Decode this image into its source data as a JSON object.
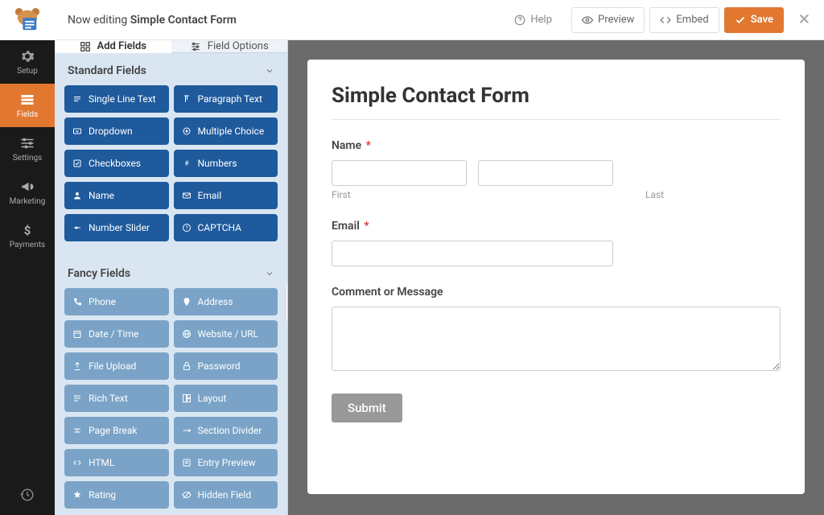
{
  "topbar": {
    "editing_prefix": "Now editing ",
    "editing_name": "Simple Contact Form",
    "help": "Help",
    "preview": "Preview",
    "embed": "Embed",
    "save": "Save"
  },
  "rail": {
    "setup": "Setup",
    "fields": "Fields",
    "settings": "Settings",
    "marketing": "Marketing",
    "payments": "Payments"
  },
  "panel": {
    "tab_add": "Add Fields",
    "tab_options": "Field Options",
    "section_standard": "Standard Fields",
    "section_fancy": "Fancy Fields",
    "standard_fields": [
      "Single Line Text",
      "Paragraph Text",
      "Dropdown",
      "Multiple Choice",
      "Checkboxes",
      "Numbers",
      "Name",
      "Email",
      "Number Slider",
      "CAPTCHA"
    ],
    "fancy_fields": [
      "Phone",
      "Address",
      "Date / Time",
      "Website / URL",
      "File Upload",
      "Password",
      "Rich Text",
      "Layout",
      "Page Break",
      "Section Divider",
      "HTML",
      "Entry Preview",
      "Rating",
      "Hidden Field"
    ]
  },
  "form": {
    "title": "Simple Contact Form",
    "name_label": "Name",
    "first": "First",
    "last": "Last",
    "email_label": "Email",
    "comment_label": "Comment or Message",
    "submit": "Submit"
  }
}
